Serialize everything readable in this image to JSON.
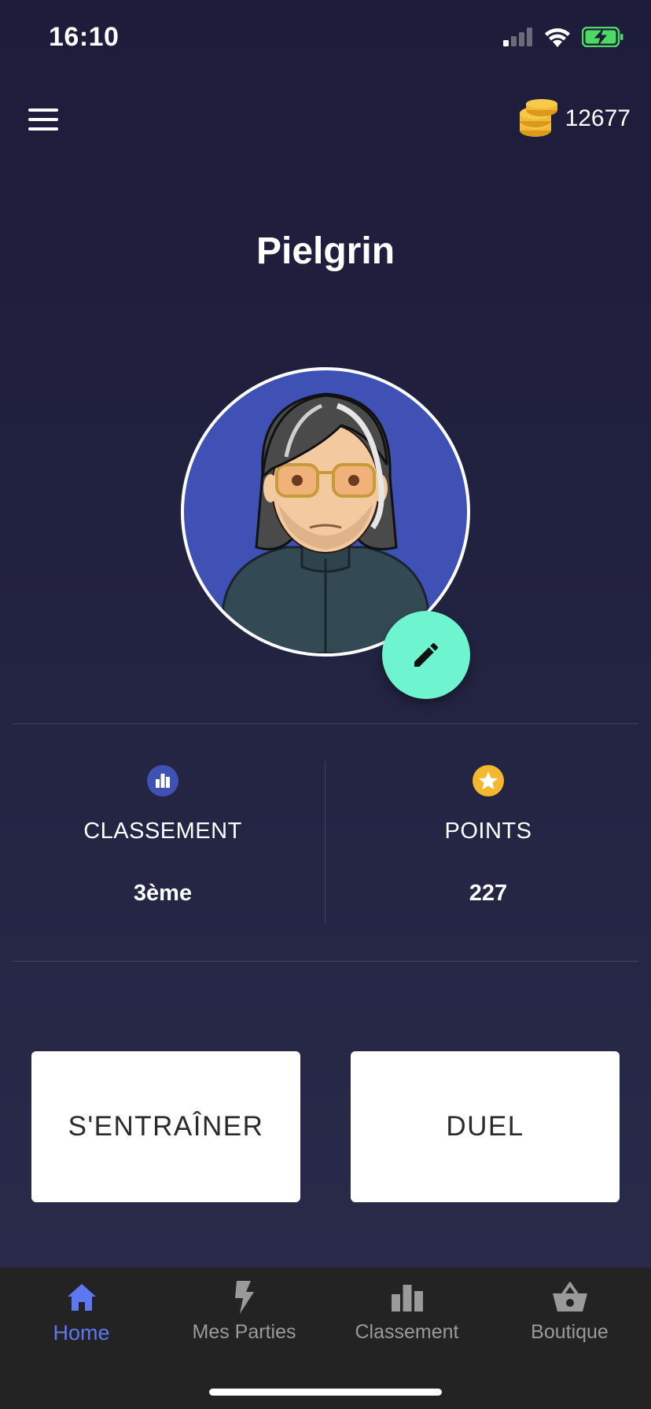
{
  "status_bar": {
    "time": "16:10"
  },
  "header": {
    "coins": "12677"
  },
  "profile": {
    "username": "Pielgrin"
  },
  "stats": [
    {
      "label": "CLASSEMENT",
      "value": "3ème",
      "icon": "ranking-icon"
    },
    {
      "label": "POINTS",
      "value": "227",
      "icon": "star-icon"
    }
  ],
  "actions": {
    "train_label": "S'ENTRAÎNER",
    "duel_label": "DUEL"
  },
  "nav": [
    {
      "label": "Home",
      "icon": "home-icon",
      "active": true
    },
    {
      "label": "Mes Parties",
      "icon": "lightning-icon",
      "active": false
    },
    {
      "label": "Classement",
      "icon": "bar-chart-icon",
      "active": false
    },
    {
      "label": "Boutique",
      "icon": "basket-icon",
      "active": false
    }
  ],
  "colors": {
    "accent": "#5e78f2",
    "edit_button": "#6ef5cf",
    "coin": "#f2b82f",
    "ranking_icon_bg": "#3f51b5",
    "star_icon_bg": "#f5b72e",
    "battery": "#4cd964"
  }
}
